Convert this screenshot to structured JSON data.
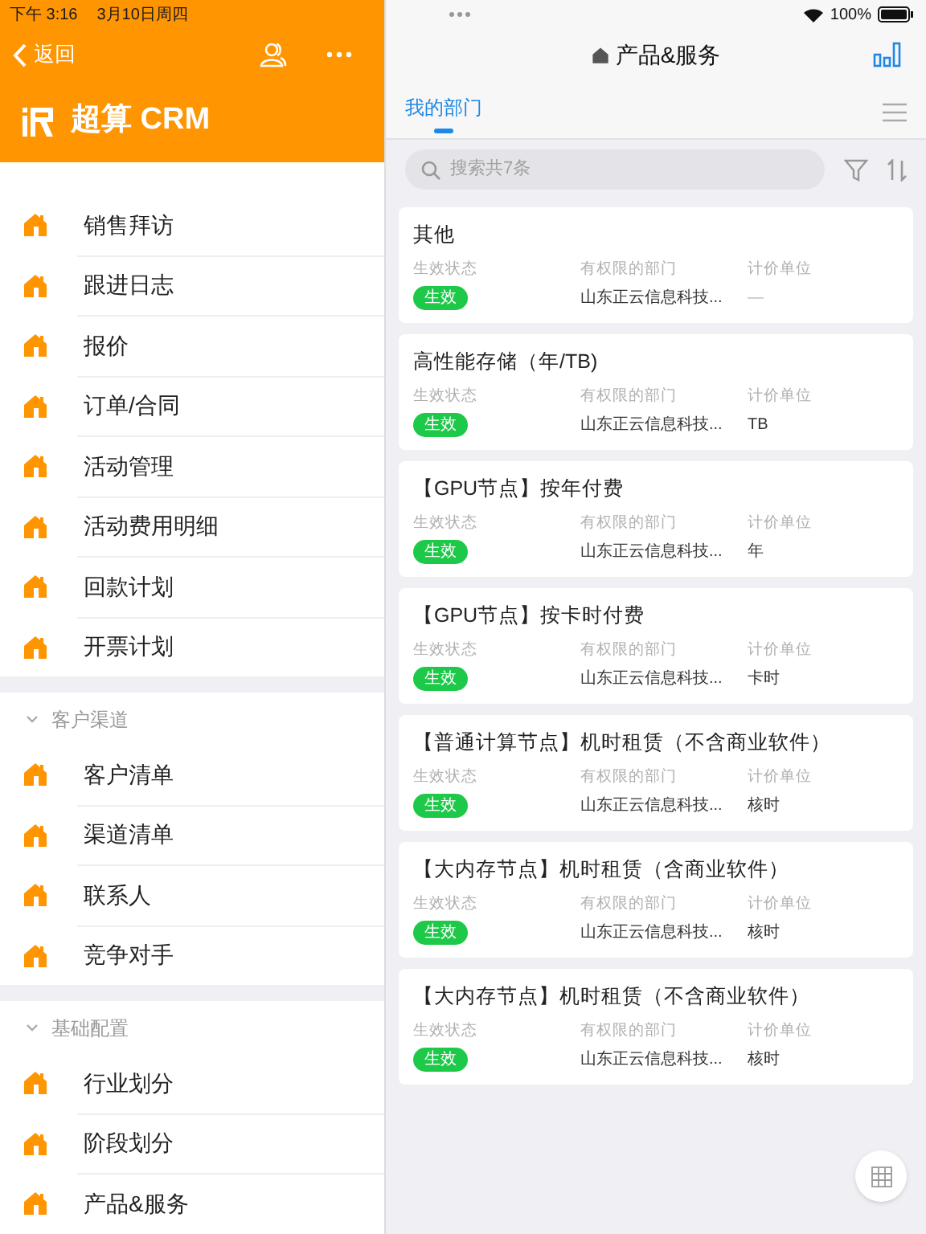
{
  "status_bar": {
    "time": "下午 3:16",
    "date": "3月10日周四",
    "battery": "100%"
  },
  "sidebar": {
    "back": "返回",
    "app_title": "超算 CRM",
    "sections": [
      {
        "items": [
          {
            "label": "销售拜访",
            "selected": false
          },
          {
            "label": "跟进日志",
            "selected": false
          },
          {
            "label": "报价",
            "selected": false
          },
          {
            "label": "订单/合同",
            "selected": false
          },
          {
            "label": "活动管理",
            "selected": false
          },
          {
            "label": "活动费用明细",
            "selected": false
          },
          {
            "label": "回款计划",
            "selected": false
          },
          {
            "label": "开票计划",
            "selected": false
          }
        ]
      },
      {
        "title": "客户渠道",
        "expanded": true,
        "items": [
          {
            "label": "客户清单",
            "selected": false
          },
          {
            "label": "渠道清单",
            "selected": false
          },
          {
            "label": "联系人",
            "selected": false
          },
          {
            "label": "竞争对手",
            "selected": false
          }
        ]
      },
      {
        "title": "基础配置",
        "expanded": true,
        "items": [
          {
            "label": "行业划分",
            "selected": false
          },
          {
            "label": "阶段划分",
            "selected": false
          },
          {
            "label": "产品&服务",
            "selected": false
          }
        ]
      }
    ]
  },
  "main": {
    "title": "产品&服务",
    "tabs": [
      {
        "label": "我的部门",
        "selected": true
      }
    ],
    "search": {
      "placeholder": "搜索共7条"
    },
    "cards": [
      {
        "title": "其他",
        "labels": [
          "生效状态",
          "有权限的部门",
          "计价单位"
        ],
        "status": "生效",
        "department": "山东正云信息科技...",
        "unit": "—"
      },
      {
        "title": "高性能存储（年/TB)",
        "labels": [
          "生效状态",
          "有权限的部门",
          "计价单位"
        ],
        "status": "生效",
        "department": "山东正云信息科技...",
        "unit": "TB"
      },
      {
        "title": "【GPU节点】按年付费",
        "labels": [
          "生效状态",
          "有权限的部门",
          "计价单位"
        ],
        "status": "生效",
        "department": "山东正云信息科技...",
        "unit": "年"
      },
      {
        "title": "【GPU节点】按卡时付费",
        "labels": [
          "生效状态",
          "有权限的部门",
          "计价单位"
        ],
        "status": "生效",
        "department": "山东正云信息科技...",
        "unit": "卡时"
      },
      {
        "title": "【普通计算节点】机时租赁（不含商业软件）",
        "labels": [
          "生效状态",
          "有权限的部门",
          "计价单位"
        ],
        "status": "生效",
        "department": "山东正云信息科技...",
        "unit": "核时"
      },
      {
        "title": "【大内存节点】机时租赁（含商业软件）",
        "labels": [
          "生效状态",
          "有权限的部门",
          "计价单位"
        ],
        "status": "生效",
        "department": "山东正云信息科技...",
        "unit": "核时"
      },
      {
        "title": "【大内存节点】机时租赁（不含商业软件）",
        "labels": [
          "生效状态",
          "有权限的部门",
          "计价单位"
        ],
        "status": "生效",
        "department": "山东正云信息科技...",
        "unit": "核时"
      }
    ]
  }
}
